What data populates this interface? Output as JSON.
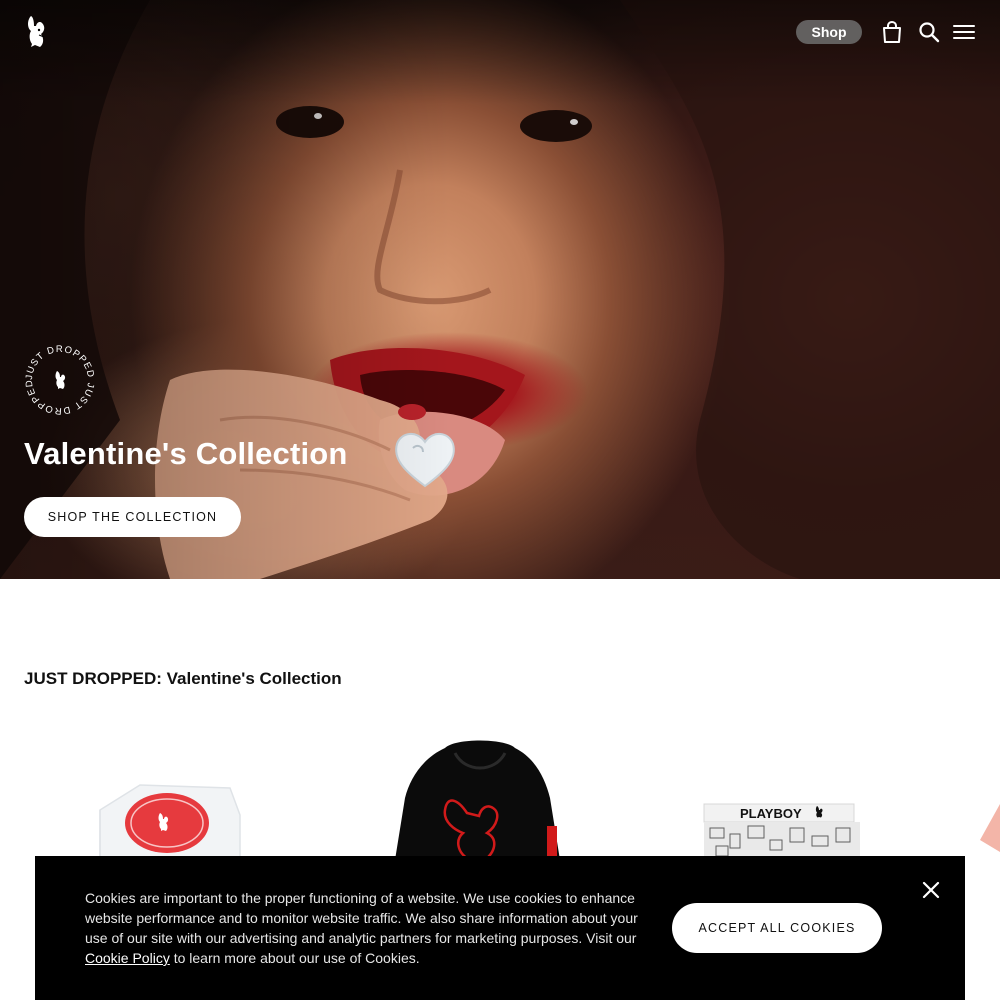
{
  "header": {
    "logo_icon": "playboy-bunny-logo",
    "shop_label": "Shop",
    "icons": [
      "shopping-bag-icon",
      "search-icon",
      "hamburger-menu-icon"
    ]
  },
  "hero": {
    "badge_text": "JUST DROPPED JUST DROPPED",
    "title": "Valentine's Collection",
    "cta_label": "SHOP THE COLLECTION"
  },
  "section": {
    "title": "JUST DROPPED: Valentine's Collection",
    "products": [
      {
        "name": "candy-cube-product",
        "label": ""
      },
      {
        "name": "black-hoodie-product",
        "label": ""
      },
      {
        "name": "printed-shorts-product",
        "label": "PLAYBOY"
      }
    ]
  },
  "cookie": {
    "text_before": "Cookies are important to the proper functioning of a website. We use cookies to enhance website performance and to monitor website traffic. We also share information about your use of our site with our advertising and analytic partners for marketing purposes. Visit our ",
    "link_text": "Cookie Policy",
    "text_after": " to learn more about our use of Cookies.",
    "accept_label": "ACCEPT ALL COOKIES"
  },
  "colors": {
    "hero_lip_red": "#a4161c",
    "hoodie_red": "#d11a1a",
    "cookie_bg": "#000000",
    "shop_pill": "#6e6e6e"
  }
}
